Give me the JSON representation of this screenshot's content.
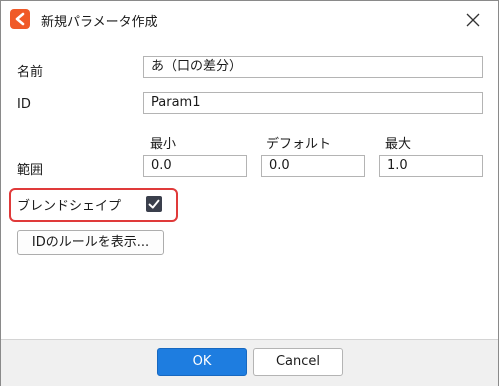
{
  "window": {
    "title": "新規パラメータ作成",
    "app_icon": "cubism-logo-icon",
    "close_icon": "close-icon"
  },
  "form": {
    "name_label": "名前",
    "name_value": "あ（口の差分）",
    "id_label": "ID",
    "id_value": "Param1",
    "range_label": "範囲",
    "min_label": "最小",
    "min_value": "0.0",
    "default_label": "デフォルト",
    "default_value": "0.0",
    "max_label": "最大",
    "max_value": "1.0",
    "blend_shape_label": "ブレンドシェイプ",
    "blend_shape_checked": true,
    "rules_button": "IDのルールを表示..."
  },
  "footer": {
    "ok_label": "OK",
    "cancel_label": "Cancel"
  },
  "colors": {
    "accent": "#1e7de0",
    "highlight": "#e03a3a",
    "app_icon": "#f05a28"
  }
}
